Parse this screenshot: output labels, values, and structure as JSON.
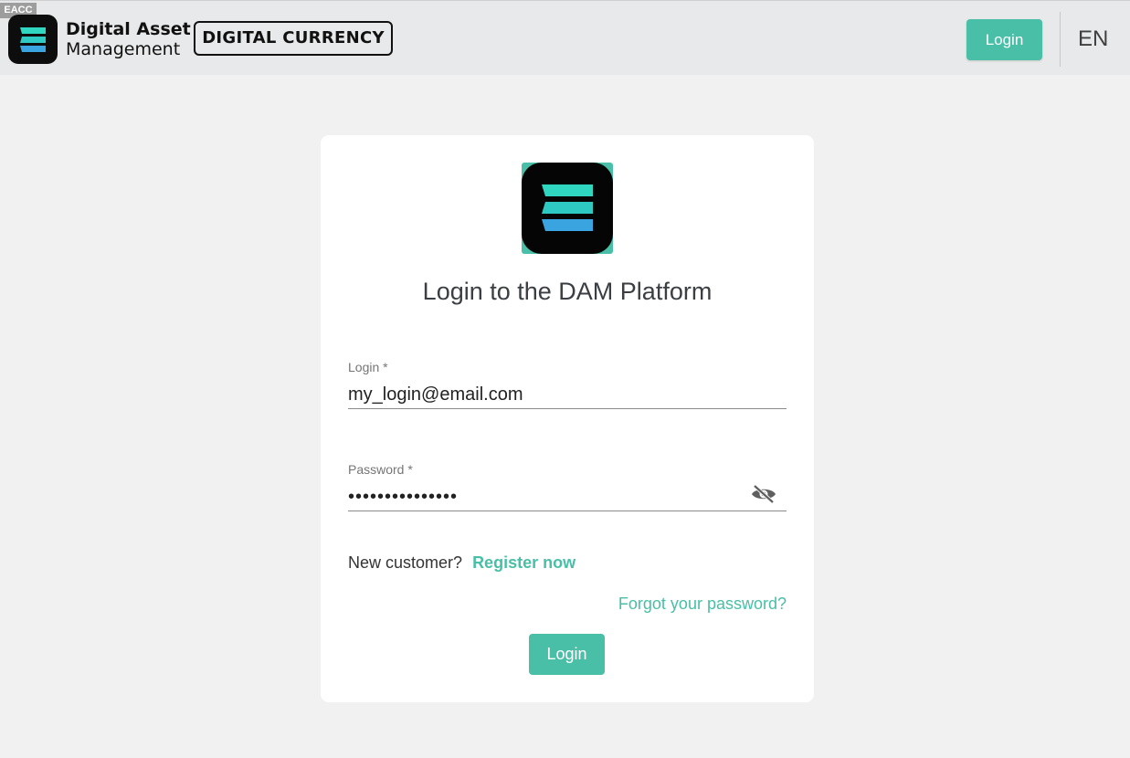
{
  "header": {
    "corner_tag": "EACC",
    "brand_line1": "Digital Asset",
    "brand_line2": "Management",
    "brand_badge": "DIGITAL CURRENCY",
    "login_label": "Login",
    "language": "EN"
  },
  "card": {
    "title": "Login to the DAM Platform",
    "login_label": "Login *",
    "login_value": "my_login@email.com",
    "password_label": "Password *",
    "password_value": "•••••••••••••••",
    "new_customer_text": "New customer?",
    "register_label": "Register now",
    "forgot_label": "Forgot your password?",
    "submit_label": "Login"
  },
  "colors": {
    "accent": "#48bfa6",
    "logo_dark": "#0d0d0d",
    "logo_stripe_teal": "#2fd6c0",
    "logo_stripe_blue": "#3aa4e0"
  },
  "icons": {
    "brand": "dam-logo-icon",
    "password_toggle": "eye-off-icon"
  }
}
